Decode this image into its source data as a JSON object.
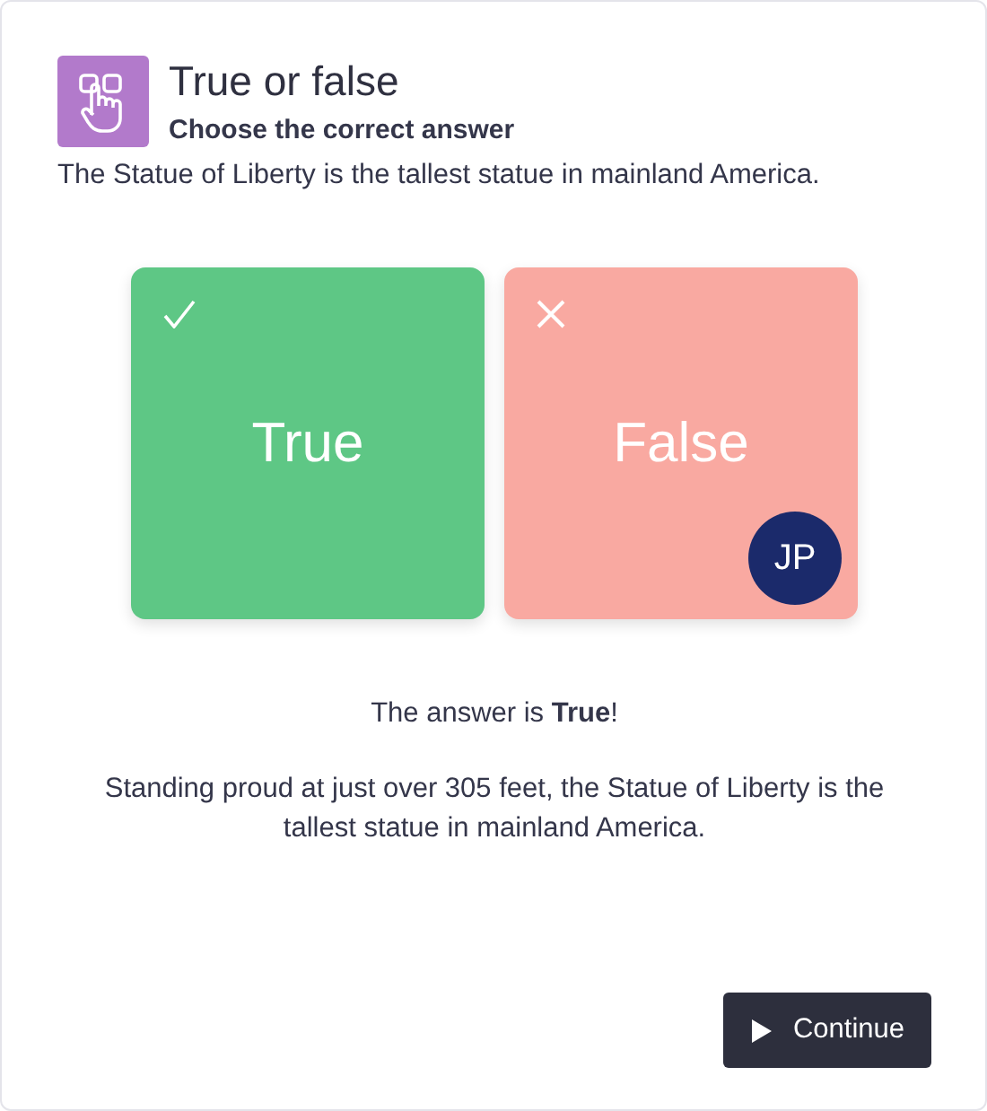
{
  "header": {
    "title": "True or false",
    "subtitle": "Choose the correct answer"
  },
  "question": "The Statue of Liberty is the tallest statue in mainland America.",
  "options": [
    {
      "label": "True",
      "kind": "correct"
    },
    {
      "label": "False",
      "kind": "incorrect",
      "picked_by": "JP"
    }
  ],
  "result": "The answer is **True**!",
  "explanation": "Standing proud at just over 305 feet, the Statue of Liberty is the tallest statue in mainland America.",
  "continue_button": "Continue"
}
